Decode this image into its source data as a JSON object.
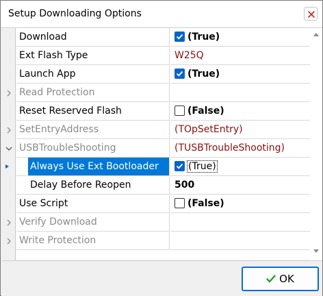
{
  "window": {
    "title": "Setup Downloading Options",
    "close_glyph": "✕"
  },
  "accent_colors": {
    "selection": "#0078d7",
    "checkbox": "#0a63c9",
    "object_value": "#8b0f0f",
    "disabled_text": "#8a8a8a"
  },
  "properties": [
    {
      "name": "Download",
      "value": "(True)",
      "checkbox": "checked"
    },
    {
      "name": "Ext Flash Type",
      "value": "W25Q"
    },
    {
      "name": "Launch App",
      "value": "(True)",
      "checkbox": "checked"
    },
    {
      "name": "Read Protection",
      "value": "",
      "expander": "collapsed"
    },
    {
      "name": "Reset Reserved Flash",
      "value": "(False)",
      "checkbox": "unchecked"
    },
    {
      "name": "SetEntryAddress",
      "value": "(TOpSetEntry)",
      "expander": "collapsed"
    },
    {
      "name": "USBTroubleShooting",
      "value": "(TUSBTroubleShooting)",
      "expander": "expanded"
    },
    {
      "name": "Always Use Ext Bootloader",
      "value": "(True)",
      "checkbox": "checked",
      "selected": true
    },
    {
      "name": "Delay Before Reopen",
      "value": "500"
    },
    {
      "name": "Use Script",
      "value": "(False)",
      "checkbox": "unchecked"
    },
    {
      "name": "Verify Download",
      "value": "",
      "expander": "collapsed"
    },
    {
      "name": "Write Protection",
      "value": "",
      "expander": "collapsed"
    }
  ],
  "footer": {
    "ok_label": "OK",
    "ok_icon": "green-check-icon"
  }
}
